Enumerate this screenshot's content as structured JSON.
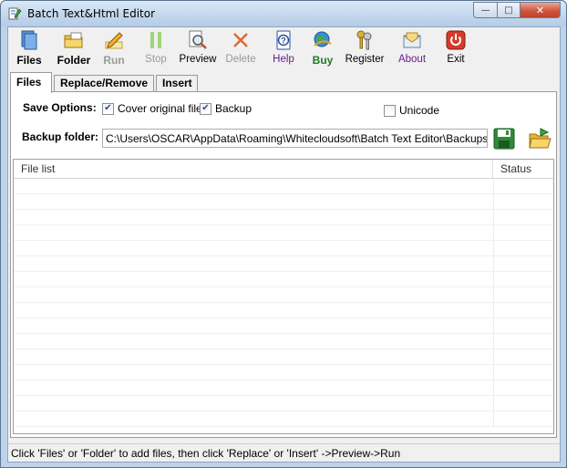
{
  "window": {
    "title": "Batch Text&Html Editor",
    "minimize": "—",
    "maximize": "□",
    "close": "✕"
  },
  "toolbar": {
    "items": [
      {
        "label": "Files",
        "icon": "files-icon",
        "style": "bold"
      },
      {
        "label": "Folder",
        "icon": "folder-icon",
        "style": "bold"
      },
      {
        "label": "Run",
        "icon": "run-pencil-icon",
        "style": "bold-gray"
      },
      {
        "label": "Stop",
        "icon": "stop-pause-icon",
        "style": "gray"
      },
      {
        "label": "Preview",
        "icon": "preview-magnifier-icon",
        "style": "normal"
      },
      {
        "label": "Delete",
        "icon": "delete-x-icon",
        "style": "gray"
      },
      {
        "label": "Help",
        "icon": "help-question-icon",
        "style": "purple"
      },
      {
        "label": "Buy",
        "icon": "buy-globe-icon",
        "style": "bold-green"
      },
      {
        "label": "Register",
        "icon": "register-keys-icon",
        "style": "normal"
      },
      {
        "label": "About",
        "icon": "about-envelope-icon",
        "style": "purple"
      },
      {
        "label": "Exit",
        "icon": "exit-power-icon",
        "style": "normal"
      }
    ]
  },
  "tabs": [
    {
      "label": "Files",
      "active": true
    },
    {
      "label": "Replace/Remove",
      "active": false
    },
    {
      "label": "Insert",
      "active": false
    }
  ],
  "save_options": {
    "label": "Save Options:",
    "cover_original": {
      "label": "Cover original file",
      "checked": true
    },
    "backup": {
      "label": "Backup",
      "checked": true
    },
    "unicode": {
      "label": "Unicode",
      "checked": false
    }
  },
  "backup_folder": {
    "label": "Backup folder:",
    "value": "C:\\Users\\OSCAR\\AppData\\Roaming\\Whitecloudsoft\\Batch Text Editor\\Backups",
    "save_icon": "floppy-disk-icon",
    "browse_icon": "open-folder-icon"
  },
  "file_list": {
    "columns": [
      "File list",
      "Status"
    ],
    "rows": []
  },
  "status_bar": {
    "text": "Click 'Files' or 'Folder' to add files, then click 'Replace' or 'Insert' ->Preview->Run"
  },
  "colors": {
    "frame": "#bcd3ea",
    "client_bg": "#f0f0f0",
    "close_red": "#c0402a",
    "link_purple": "#6a1c8f",
    "buy_green": "#1f7a1f"
  }
}
